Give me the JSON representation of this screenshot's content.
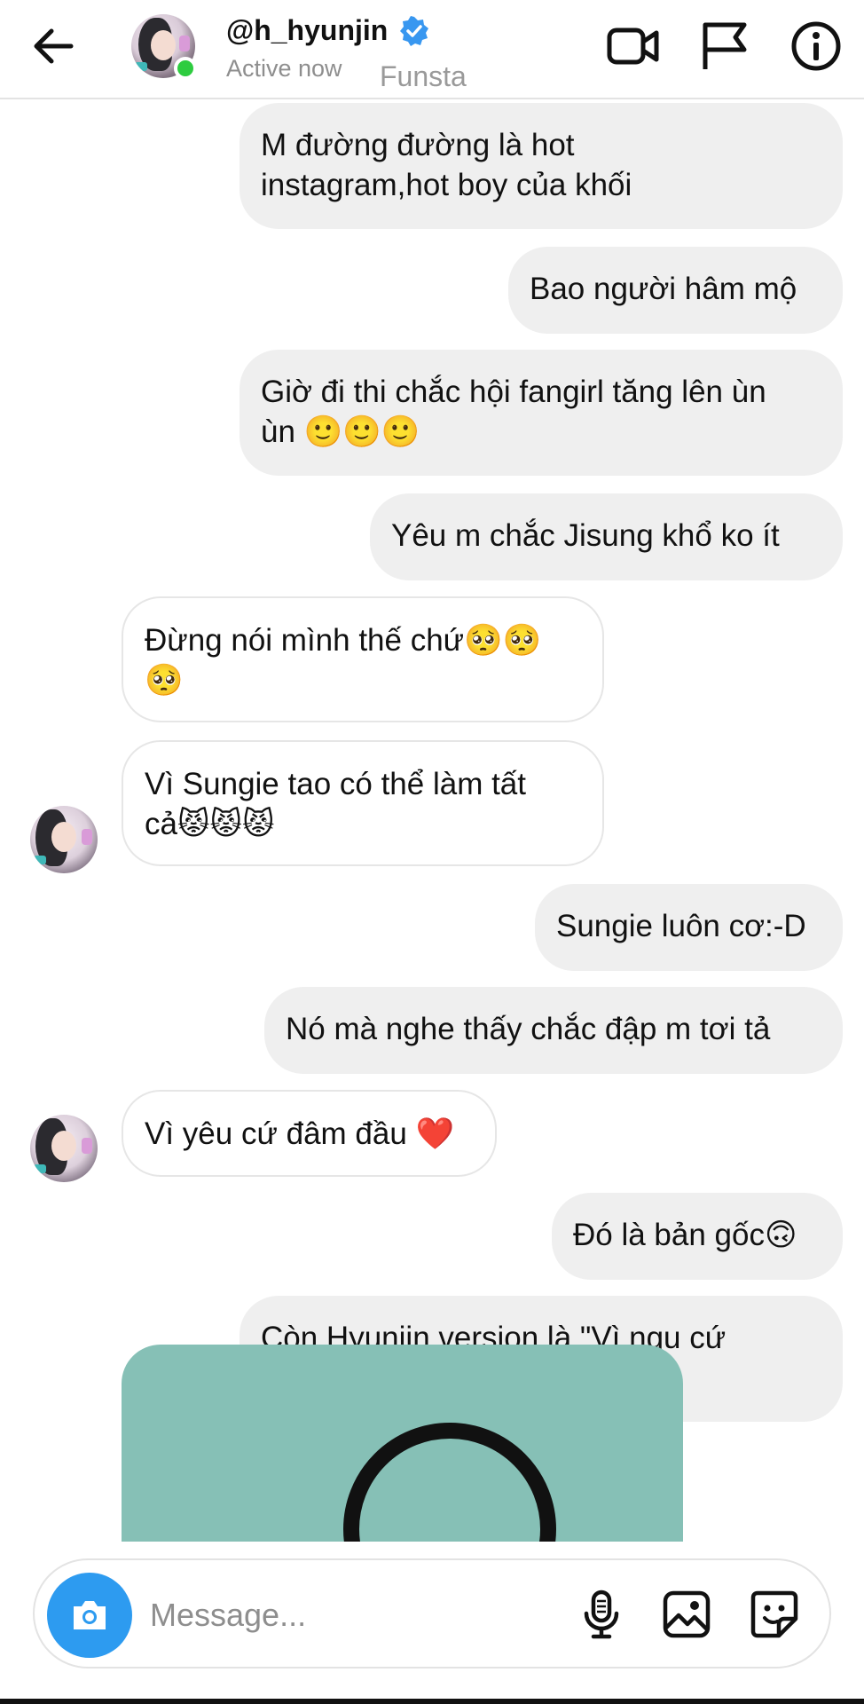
{
  "header": {
    "username": "@h_hyunjin",
    "status": "Active now",
    "account_label": "Funsta",
    "icons": {
      "back": "back-arrow-icon",
      "verified": "verified-badge-icon",
      "video": "video-call-icon",
      "flag": "flag-icon",
      "info": "info-icon"
    }
  },
  "messages": [
    {
      "direction": "sent",
      "text": "M đường đường là hot\ninstagram,hot boy của khối"
    },
    {
      "direction": "sent",
      "text": "Bao người hâm mộ"
    },
    {
      "direction": "sent",
      "text": "Giờ đi thi chắc hội fangirl tăng lên ùn\nùn 🙂🙂🙂"
    },
    {
      "direction": "sent",
      "text": "Yêu m chắc Jisung khổ ko ít"
    },
    {
      "direction": "received",
      "text": "Đừng nói mình thế chứ🥺🥺\n🥺"
    },
    {
      "direction": "received",
      "text": "Vì Sungie tao có thể làm tất\ncả😾😾😾"
    },
    {
      "direction": "sent",
      "text": "Sungie luôn cơ:-D"
    },
    {
      "direction": "sent",
      "text": "Nó mà nghe thấy chắc đập m tơi tả"
    },
    {
      "direction": "received",
      "text": "Vì yêu cứ đâm đầu ❤️"
    },
    {
      "direction": "sent",
      "text": "Đó là bản gốc🙃"
    },
    {
      "direction": "sent",
      "text": "Còn Hyunjin version là \"Vì ngu cứ\nđâm đầu\"=))"
    }
  ],
  "composer": {
    "placeholder": "Message...",
    "icons": {
      "camera": "camera-icon",
      "mic": "microphone-icon",
      "gallery": "gallery-icon",
      "sticker": "sticker-icon"
    }
  },
  "colors": {
    "sent_bubble": "#efefef",
    "received_border": "#e6e6e6",
    "online": "#2ecc40",
    "verified": "#3897f0",
    "camera_button": "#2d9bf0",
    "media_background": "#86c0b6"
  }
}
